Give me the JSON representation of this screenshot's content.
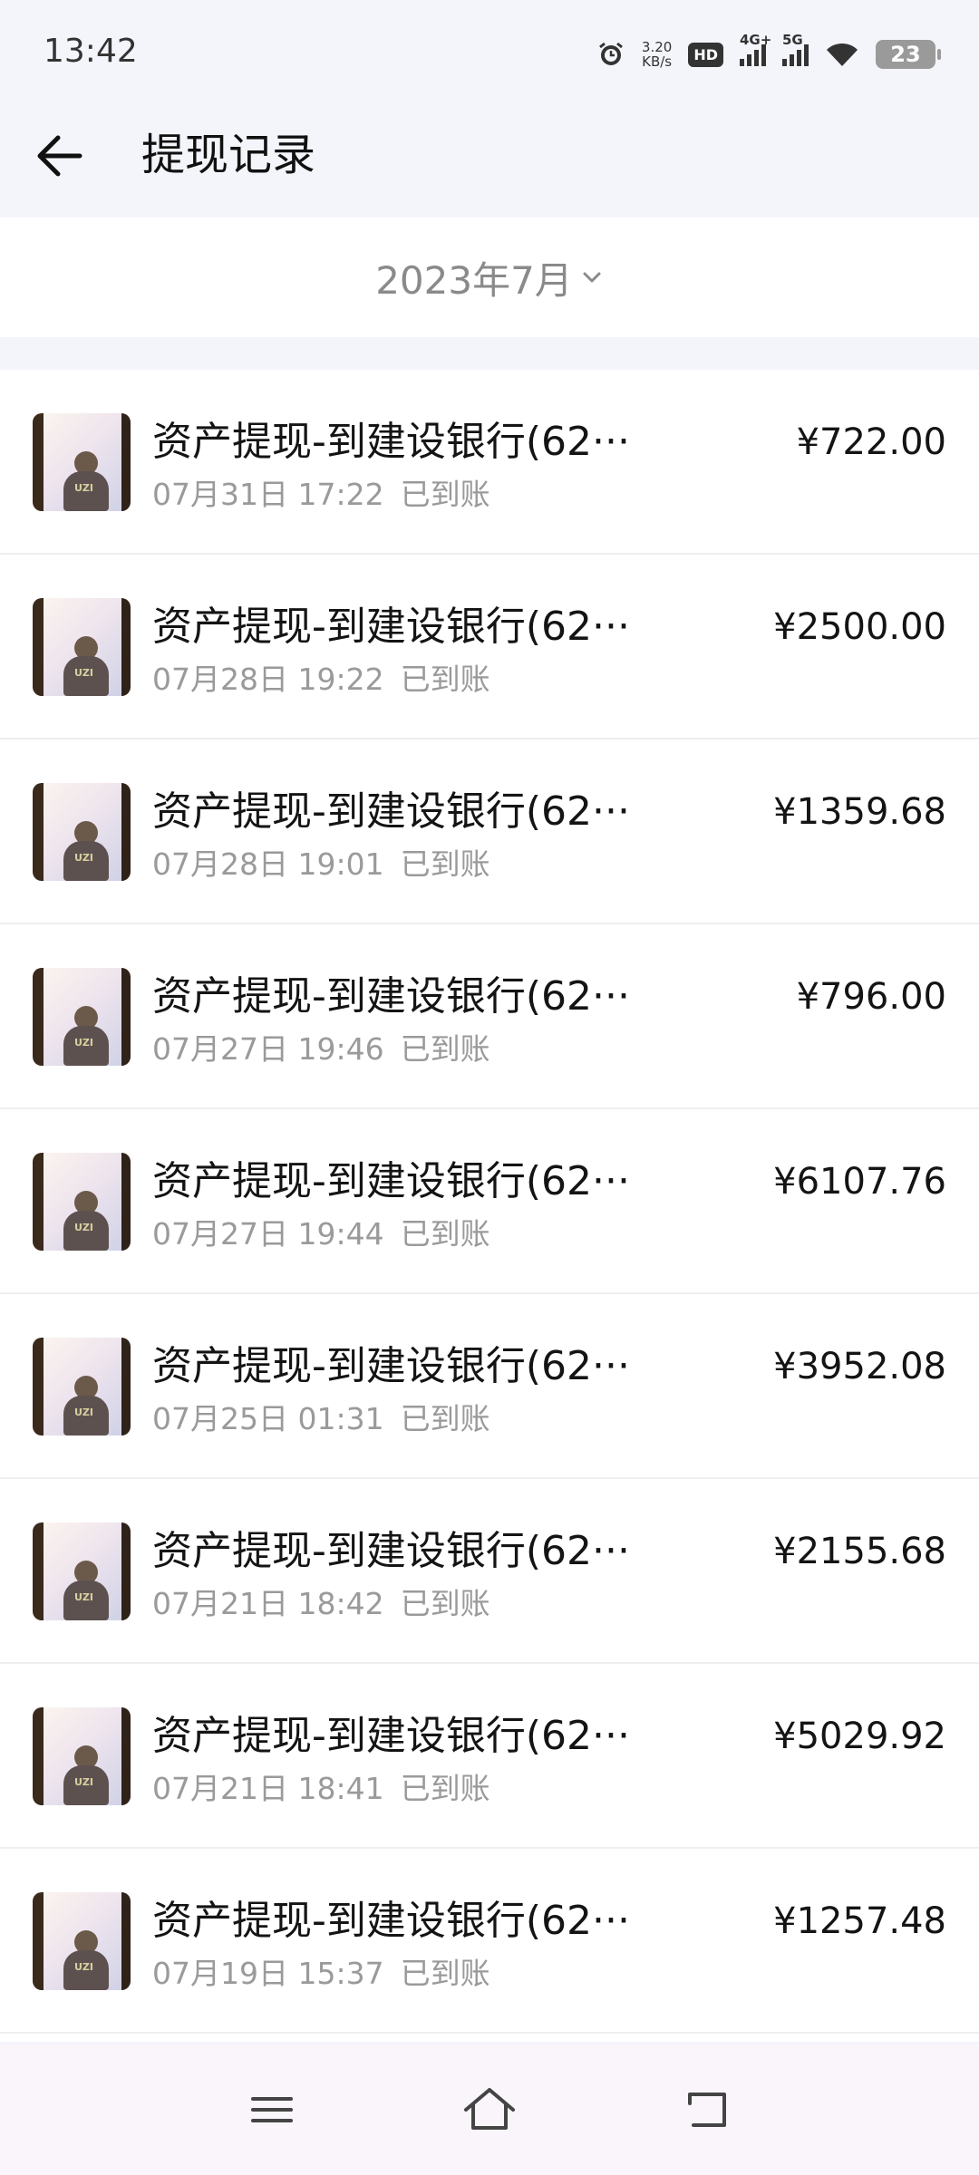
{
  "status": {
    "time": "13:42",
    "net_speed_value": "3.20",
    "net_speed_unit": "KB/s",
    "hd_label": "HD",
    "sim1_label": "4G+",
    "sim2_label": "5G",
    "battery_level": "23"
  },
  "header": {
    "title": "提现记录"
  },
  "month": {
    "label": "2023年7月"
  },
  "records": [
    {
      "title": "资产提现-到建设银行(62···",
      "date": "07月31日 17:22",
      "status": "已到账",
      "amount": "¥722.00"
    },
    {
      "title": "资产提现-到建设银行(62···",
      "date": "07月28日 19:22",
      "status": "已到账",
      "amount": "¥2500.00"
    },
    {
      "title": "资产提现-到建设银行(62···",
      "date": "07月28日 19:01",
      "status": "已到账",
      "amount": "¥1359.68"
    },
    {
      "title": "资产提现-到建设银行(62···",
      "date": "07月27日 19:46",
      "status": "已到账",
      "amount": "¥796.00"
    },
    {
      "title": "资产提现-到建设银行(62···",
      "date": "07月27日 19:44",
      "status": "已到账",
      "amount": "¥6107.76"
    },
    {
      "title": "资产提现-到建设银行(62···",
      "date": "07月25日 01:31",
      "status": "已到账",
      "amount": "¥3952.08"
    },
    {
      "title": "资产提现-到建设银行(62···",
      "date": "07月21日 18:42",
      "status": "已到账",
      "amount": "¥2155.68"
    },
    {
      "title": "资产提现-到建设银行(62···",
      "date": "07月21日 18:41",
      "status": "已到账",
      "amount": "¥5029.92"
    },
    {
      "title": "资产提现-到建设银行(62···",
      "date": "07月19日 15:37",
      "status": "已到账",
      "amount": "¥1257.48"
    }
  ],
  "avatar_text": "UZI",
  "icons": {
    "back": "arrow-left-icon",
    "month_chevron": "chevron-down-icon",
    "nav_menu": "menu-icon",
    "nav_home": "home-icon",
    "nav_back": "back-icon"
  },
  "colors": {
    "page_background": "#f4f5fb",
    "secondary_text": "#9a9a9a",
    "primary_text": "#141414"
  }
}
